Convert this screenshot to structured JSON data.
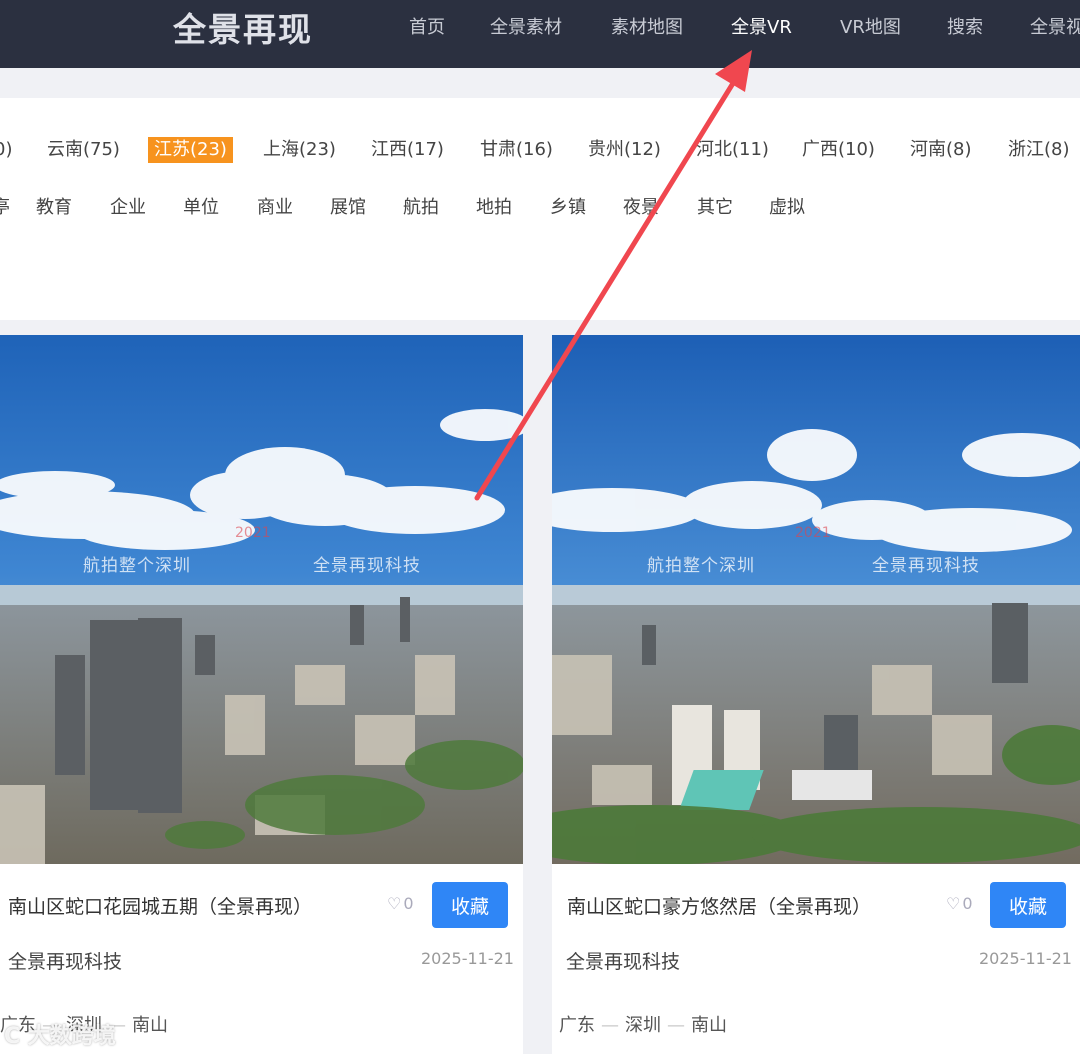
{
  "header": {
    "logo": "全景再现",
    "nav": [
      "首页",
      "全景素材",
      "素材地图",
      "全景VR",
      "VR地图",
      "搜索",
      "全景视"
    ],
    "active_index": 3
  },
  "filters": {
    "regions": [
      "0)",
      "云南(75)",
      "江苏(23)",
      "上海(23)",
      "江西(17)",
      "甘肃(16)",
      "贵州(12)",
      "河北(11)",
      "广西(10)",
      "河南(8)",
      "浙江(8)"
    ],
    "selected_region": "江苏(23)",
    "categories": [
      "亭",
      "教育",
      "企业",
      "单位",
      "商业",
      "展馆",
      "航拍",
      "地拍",
      "乡镇",
      "夜景",
      "其它",
      "虚拟"
    ]
  },
  "cards": [
    {
      "title": "南山区蛇口花园城五期（全景再现）",
      "likes": "0",
      "fav_label": "收藏",
      "author": "全景再现科技",
      "date": "2025-11-21",
      "location": [
        "广东",
        "深圳",
        "南山"
      ],
      "watermark_left": "航拍整个深圳",
      "watermark_year": "2021",
      "watermark_right": "全景再现科技"
    },
    {
      "title": "南山区蛇口豪方悠然居（全景再现）",
      "likes": "0",
      "fav_label": "收藏",
      "author": "全景再现科技",
      "date": "2025-11-21",
      "location": [
        "广东",
        "深圳",
        "南山"
      ],
      "watermark_left": "航拍整个深圳",
      "watermark_year": "2021",
      "watermark_right": "全景再现科技"
    }
  ],
  "corner_watermark": "C 大数跨境",
  "colors": {
    "header_bg": "#2b3040",
    "selected_chip": "#f7931e",
    "primary_button": "#2f86f6",
    "arrow": "#f0474f"
  },
  "icons": {
    "like": "heart-outline-icon",
    "annotation": "red-arrow-pointer"
  }
}
